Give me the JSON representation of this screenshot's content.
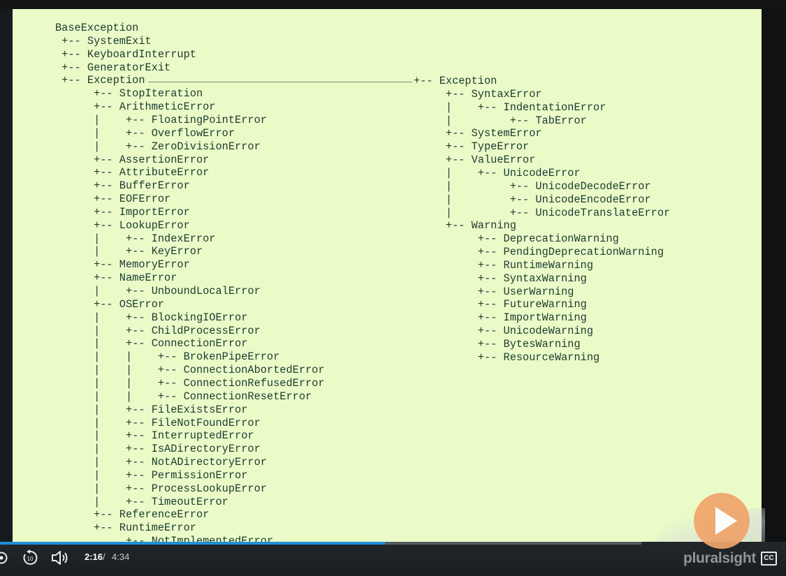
{
  "hierarchy": {
    "left": [
      "BaseException",
      " +-- SystemExit",
      " +-- KeyboardInterrupt",
      " +-- GeneratorExit",
      " +-- Exception",
      "      +-- StopIteration",
      "      +-- ArithmeticError",
      "      |    +-- FloatingPointError",
      "      |    +-- OverflowError",
      "      |    +-- ZeroDivisionError",
      "      +-- AssertionError",
      "      +-- AttributeError",
      "      +-- BufferError",
      "      +-- EOFError",
      "      +-- ImportError",
      "      +-- LookupError",
      "      |    +-- IndexError",
      "      |    +-- KeyError",
      "      +-- MemoryError",
      "      +-- NameError",
      "      |    +-- UnboundLocalError",
      "      +-- OSError",
      "      |    +-- BlockingIOError",
      "      |    +-- ChildProcessError",
      "      |    +-- ConnectionError",
      "      |    |    +-- BrokenPipeError",
      "      |    |    +-- ConnectionAbortedError",
      "      |    |    +-- ConnectionRefusedError",
      "      |    |    +-- ConnectionResetError",
      "      |    +-- FileExistsError",
      "      |    +-- FileNotFoundError",
      "      |    +-- InterruptedError",
      "      |    +-- IsADirectoryError",
      "      |    +-- NotADirectoryError",
      "      |    +-- PermissionError",
      "      |    +-- ProcessLookupError",
      "      |    +-- TimeoutError",
      "      +-- ReferenceError",
      "      +-- RuntimeError",
      "           +-- NotImplementedError"
    ],
    "right": [
      "+-- Exception",
      "     +-- SyntaxError",
      "     |    +-- IndentationError",
      "     |         +-- TabError",
      "     +-- SystemError",
      "     +-- TypeError",
      "     +-- ValueError",
      "     |    +-- UnicodeError",
      "     |         +-- UnicodeDecodeError",
      "     |         +-- UnicodeEncodeError",
      "     |         +-- UnicodeTranslateError",
      "     +-- Warning",
      "          +-- DeprecationWarning",
      "          +-- PendingDeprecationWarning",
      "          +-- RuntimeWarning",
      "          +-- SyntaxWarning",
      "          +-- UserWarning",
      "          +-- FutureWarning",
      "          +-- ImportWarning",
      "          +-- UnicodeWarning",
      "          +-- BytesWarning",
      "          +-- ResourceWarning"
    ]
  },
  "player": {
    "time_current": "2:16",
    "time_separator": "/",
    "time_total": "4:34",
    "progress_fraction": 0.49,
    "brand": "pluralsight",
    "cc_label": "CC",
    "rewind_seconds": "10",
    "accent_color": "#1f90d8",
    "play_button_color": "#f0a56b"
  }
}
